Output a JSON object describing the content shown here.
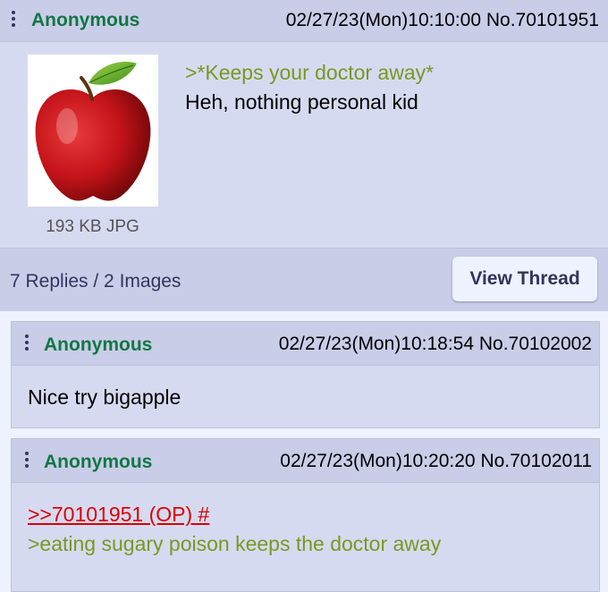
{
  "op": {
    "name": "Anonymous",
    "datetime": "02/27/23(Mon)10:10:00",
    "post_no": "No.70101951",
    "file_info": "193 KB JPG",
    "greentext": ">*Keeps your doctor away*",
    "text": "Heh, nothing personal kid",
    "replies_summary": "7 Replies / 2 Images",
    "view_thread_label": "View Thread",
    "image_alt": "red apple"
  },
  "replies": [
    {
      "name": "Anonymous",
      "datetime": "02/27/23(Mon)10:18:54",
      "post_no": "No.70102002",
      "text": "Nice try bigapple"
    },
    {
      "name": "Anonymous",
      "datetime": "02/27/23(Mon)10:20:20",
      "post_no": "No.70102011",
      "quotelink": ">>70101951 (OP) #",
      "greentext": ">eating sugary poison keeps the doctor away"
    }
  ],
  "colors": {
    "name": "#117743",
    "greentext": "#789922",
    "quotelink": "#dd0000",
    "post_bg": "#d6daf0",
    "header_bg": "#c9cde8"
  }
}
